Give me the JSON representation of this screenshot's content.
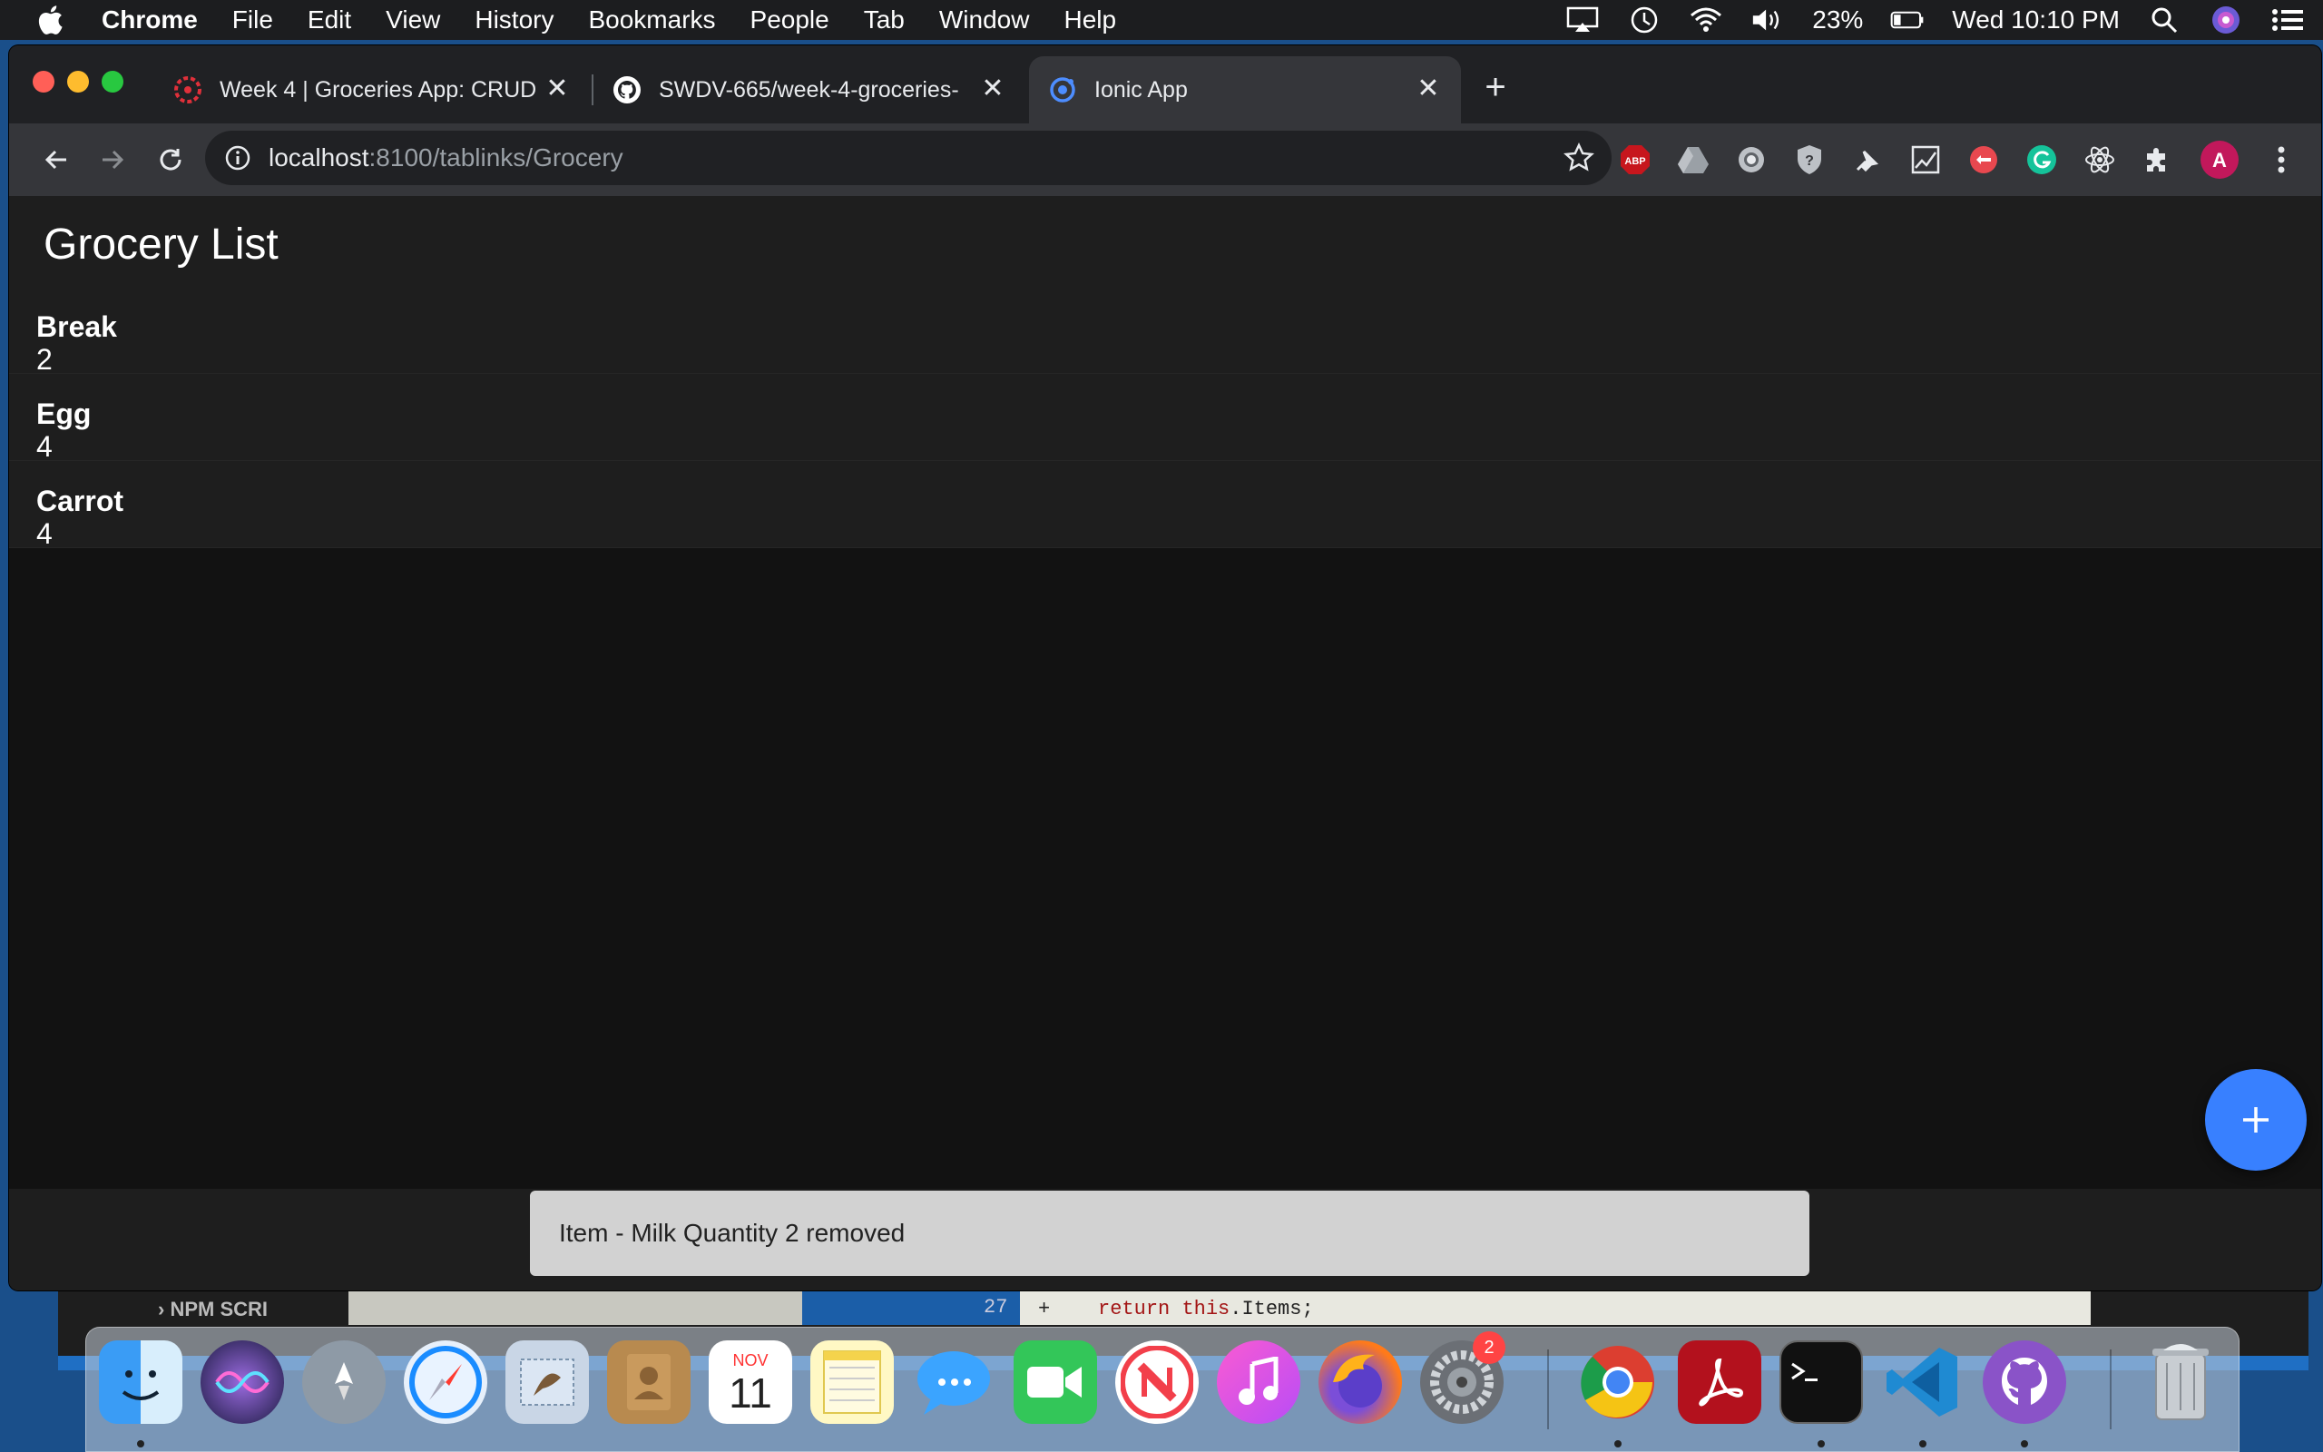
{
  "menubar": {
    "app_name": "Chrome",
    "items": [
      "File",
      "Edit",
      "View",
      "History",
      "Bookmarks",
      "People",
      "Tab",
      "Window",
      "Help"
    ],
    "battery": "23%",
    "clock": "Wed 10:10 PM"
  },
  "browser": {
    "tabs": [
      {
        "title": "Week 4 | Groceries App: CRUD",
        "icon": "lms-icon"
      },
      {
        "title": "SWDV-665/week-4-groceries-",
        "icon": "github-icon"
      },
      {
        "title": "Ionic App",
        "icon": "ionic-icon"
      }
    ],
    "url_host": "localhost",
    "url_path": ":8100/tablinks/Grocery",
    "profile_initial": "A",
    "abp_label": "ABP"
  },
  "app": {
    "title": "Grocery List",
    "items": [
      {
        "name": "Break",
        "quantity": "2"
      },
      {
        "name": "Egg",
        "quantity": "4"
      },
      {
        "name": "Carrot",
        "quantity": "4"
      }
    ],
    "toast": "Item - Milk Quantity 2 removed",
    "accent": "#3880ff"
  },
  "background_editor": {
    "section_label": "NPM SCRI",
    "line_number": "27",
    "diff_marker": "+",
    "code_keyword": "return",
    "code_this": "this",
    "code_rest": ".Items;"
  },
  "dock": {
    "calendar_month": "NOV",
    "calendar_day": "11",
    "settings_badge": "2"
  }
}
